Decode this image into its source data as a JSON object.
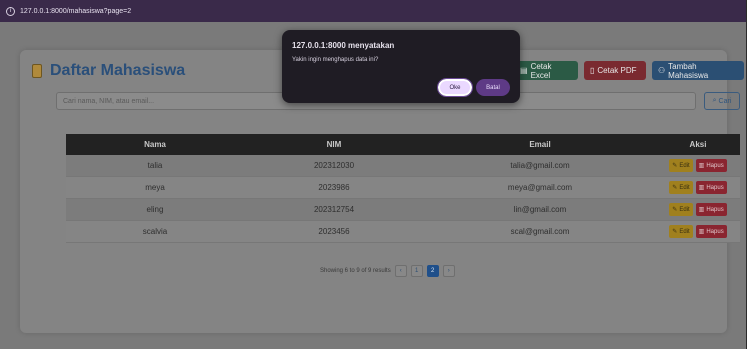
{
  "browser": {
    "url": "127.0.0.1:8000/mahasiswa?page=2"
  },
  "page": {
    "title": "Daftar Mahasiswa",
    "actions": {
      "excel_label": "Cetak Excel",
      "pdf_label": "Cetak PDF",
      "tambah_label": "Tambah Mahasiswa"
    },
    "search": {
      "placeholder": "Cari nama, NIM, atau email...",
      "button_label": "Cari"
    }
  },
  "table": {
    "headers": [
      "Nama",
      "NIM",
      "Email",
      "Aksi"
    ],
    "rows": [
      {
        "nama": "talia",
        "nim": "202312030",
        "email": "talia@gmail.com"
      },
      {
        "nama": "meya",
        "nim": "2023986",
        "email": "meya@gmail.com"
      },
      {
        "nama": "eling",
        "nim": "202312754",
        "email": "lin@gmail.com"
      },
      {
        "nama": "scalvia",
        "nim": "2023456",
        "email": "scal@gmail.com"
      }
    ],
    "edit_label": "Edit",
    "hapus_label": "Hapus"
  },
  "pagination": {
    "summary": "Showing 6 to 9 of 9 results",
    "prev": "‹",
    "pages": [
      "1",
      "2"
    ],
    "next": "›",
    "current": "2"
  },
  "dialog": {
    "title": "127.0.0.1:8000 menyatakan",
    "message": "Yakin ingin menghapus data ini?",
    "ok_label": "Oke",
    "cancel_label": "Batal"
  },
  "colors": {
    "excel": "#2b5a45",
    "pdf": "#7a2a30",
    "tambah": "#2b4f73",
    "dialog_bg": "#1f1c24"
  }
}
